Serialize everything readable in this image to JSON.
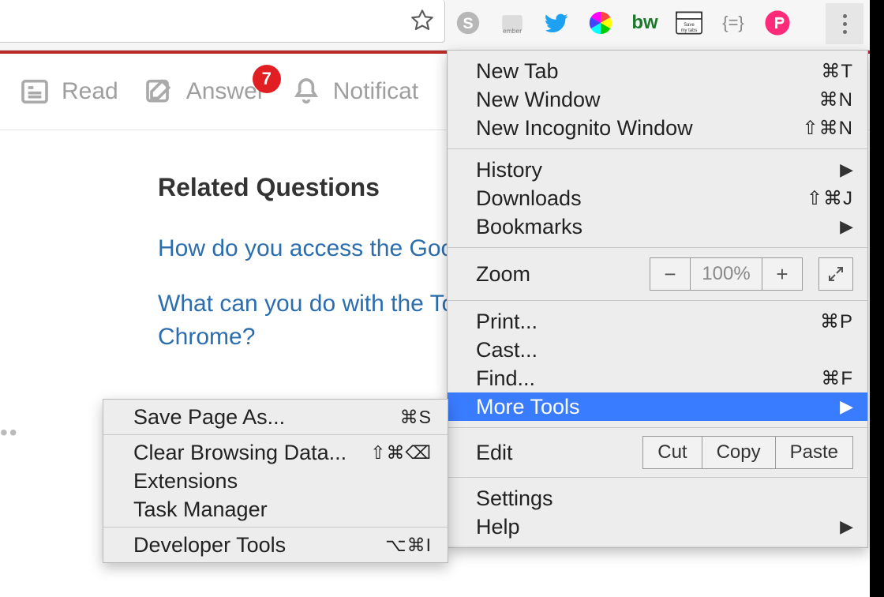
{
  "toolbar": {
    "extensions": [
      "skype",
      "ember",
      "twitter",
      "colorwheel",
      "bw",
      "savemytabs",
      "braces",
      "pink-t"
    ]
  },
  "page": {
    "tabs": {
      "read": "Read",
      "answer": "Answer",
      "answer_badge": "7",
      "notifications": "Notificat"
    },
    "section_title": "Related Questions",
    "links": {
      "q1": "How do you access the Google",
      "q2": "What can you do with the Tools",
      "q2b": "Chrome?"
    }
  },
  "menu": {
    "new_tab": {
      "label": "New Tab",
      "shortcut": "⌘T"
    },
    "new_window": {
      "label": "New Window",
      "shortcut": "⌘N"
    },
    "incognito": {
      "label": "New Incognito Window",
      "shortcut": "⇧⌘N"
    },
    "history": {
      "label": "History"
    },
    "downloads": {
      "label": "Downloads",
      "shortcut": "⇧⌘J"
    },
    "bookmarks": {
      "label": "Bookmarks"
    },
    "zoom": {
      "label": "Zoom",
      "value": "100%"
    },
    "print": {
      "label": "Print...",
      "shortcut": "⌘P"
    },
    "cast": {
      "label": "Cast..."
    },
    "find": {
      "label": "Find...",
      "shortcut": "⌘F"
    },
    "more_tools": {
      "label": "More Tools"
    },
    "edit": {
      "label": "Edit",
      "cut": "Cut",
      "copy": "Copy",
      "paste": "Paste"
    },
    "settings": {
      "label": "Settings"
    },
    "help": {
      "label": "Help"
    }
  },
  "submenu": {
    "save_as": {
      "label": "Save Page As...",
      "shortcut": "⌘S"
    },
    "clear_data": {
      "label": "Clear Browsing Data...",
      "shortcut": "⇧⌘⌫"
    },
    "extensions": {
      "label": "Extensions"
    },
    "task_manager": {
      "label": "Task Manager"
    },
    "dev_tools": {
      "label": "Developer Tools",
      "shortcut": "⌥⌘I"
    }
  }
}
